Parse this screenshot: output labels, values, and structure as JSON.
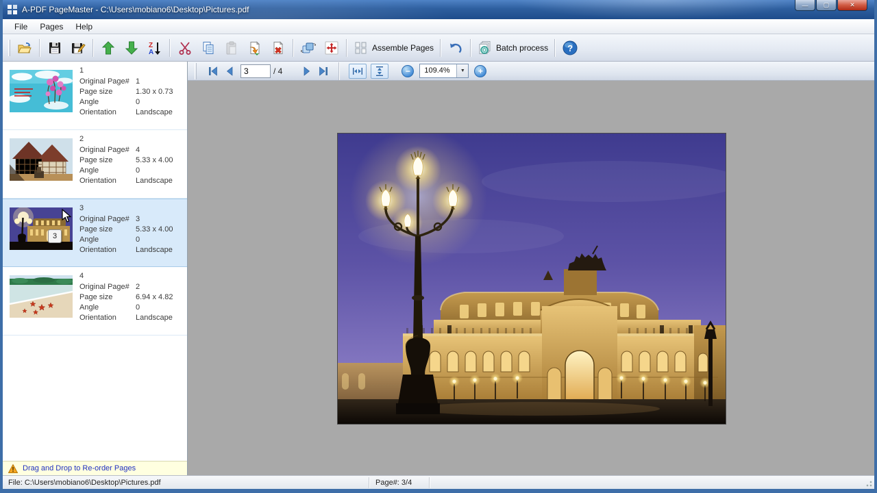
{
  "window": {
    "title": "A-PDF PageMaster - C:\\Users\\mobiano6\\Desktop\\Pictures.pdf",
    "controls": {
      "minimize": "—",
      "maximize": "▢",
      "close": "✕"
    }
  },
  "menu": {
    "file": "File",
    "pages": "Pages",
    "help": "Help"
  },
  "toolbar": {
    "assemble_label": "Assemble Pages",
    "batch_label": "Batch process",
    "icons": [
      "open-folder",
      "save",
      "save-as",
      "move-up",
      "move-down",
      "sort",
      "cut",
      "copy",
      "paste",
      "import-page",
      "delete-page",
      "rotate",
      "move",
      "assemble-grid",
      "undo",
      "batch-gear",
      "help"
    ]
  },
  "nav": {
    "page": "3",
    "of": "/ 4",
    "zoom": "109.4%",
    "icons": [
      "first-page",
      "prev-page",
      "next-page",
      "last-page",
      "fit-width",
      "fit-height",
      "zoom-out",
      "zoom-in"
    ]
  },
  "page_labels": {
    "original": "Original Page#",
    "size": "Page size",
    "angle": "Angle",
    "orientation": "Orientation"
  },
  "pages": [
    {
      "num": "1",
      "original": "1",
      "size": "1.30 x 0.73",
      "angle": "0",
      "orientation": "Landscape"
    },
    {
      "num": "2",
      "original": "4",
      "size": "5.33 x 4.00",
      "angle": "0",
      "orientation": "Landscape"
    },
    {
      "num": "3",
      "original": "3",
      "size": "5.33 x 4.00",
      "angle": "0",
      "orientation": "Landscape",
      "drag_badge": "3"
    },
    {
      "num": "4",
      "original": "2",
      "size": "6.94 x 4.82",
      "angle": "0",
      "orientation": "Landscape"
    }
  ],
  "hint": "Drag and Drop to Re-order Pages",
  "status": {
    "file": "File: C:\\Users\\mobiano6\\Desktop\\Pictures.pdf",
    "page": "Page#: 3/4"
  },
  "colors": {
    "titlebar": "#2e5f9f",
    "selection": "#d8eafa",
    "hint_bg": "#ffffe0",
    "preview_bg": "#a9a9a9"
  }
}
